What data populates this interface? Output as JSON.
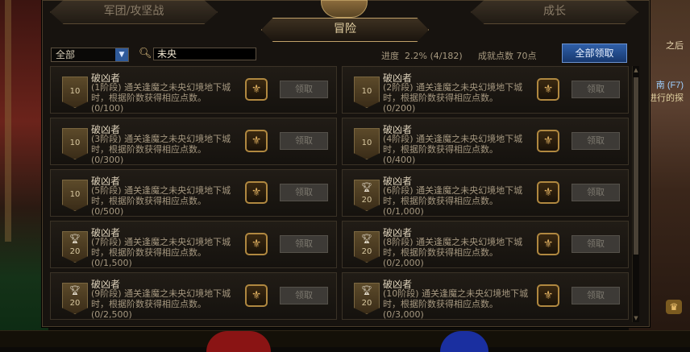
{
  "tabs": {
    "left": "军团/攻坚战",
    "active": "冒险",
    "right": "成长"
  },
  "filter": {
    "selected": "全部"
  },
  "search": {
    "value": "未央"
  },
  "progress": {
    "label": "进度",
    "value": "2.2% (4/182)"
  },
  "points": {
    "label": "成就点数",
    "value": "70点"
  },
  "claim_all_label": "全部领取",
  "claim_label": "领取",
  "side": {
    "t1": "之后",
    "t2": "南 (F7)",
    "t3": "进行的探"
  },
  "cards": [
    {
      "name": "破凶者",
      "desc": "(1阶段) 通关逢魔之未央幻境地下城时，根据阶数获得相应点数。",
      "prog": "(0/100)",
      "badge": "10"
    },
    {
      "name": "破凶者",
      "desc": "(2阶段) 通关逢魔之未央幻境地下城时，根据阶数获得相应点数。",
      "prog": "(0/200)",
      "badge": "10"
    },
    {
      "name": "破凶者",
      "desc": "(3阶段) 通关逢魔之未央幻境地下城时，根据阶数获得相应点数。",
      "prog": "(0/300)",
      "badge": "10"
    },
    {
      "name": "破凶者",
      "desc": "(4阶段) 通关逢魔之未央幻境地下城时，根据阶数获得相应点数。",
      "prog": "(0/400)",
      "badge": "10"
    },
    {
      "name": "破凶者",
      "desc": "(5阶段) 通关逢魔之未央幻境地下城时，根据阶数获得相应点数。",
      "prog": "(0/500)",
      "badge": "10"
    },
    {
      "name": "破凶者",
      "desc": "(6阶段) 通关逢魔之未央幻境地下城时，根据阶数获得相应点数。",
      "prog": "(0/1,000)",
      "badge": "20"
    },
    {
      "name": "破凶者",
      "desc": "(7阶段) 通关逢魔之未央幻境地下城时，根据阶数获得相应点数。",
      "prog": "(0/1,500)",
      "badge": "20"
    },
    {
      "name": "破凶者",
      "desc": "(8阶段) 通关逢魔之未央幻境地下城时，根据阶数获得相应点数。",
      "prog": "(0/2,000)",
      "badge": "20"
    },
    {
      "name": "破凶者",
      "desc": "(9阶段) 通关逢魔之未央幻境地下城时，根据阶数获得相应点数。",
      "prog": "(0/2,500)",
      "badge": "20"
    },
    {
      "name": "破凶者",
      "desc": "(10阶段) 通关逢魔之未央幻境地下城时，根据阶数获得相应点数。",
      "prog": "(0/3,000)",
      "badge": "20"
    }
  ]
}
